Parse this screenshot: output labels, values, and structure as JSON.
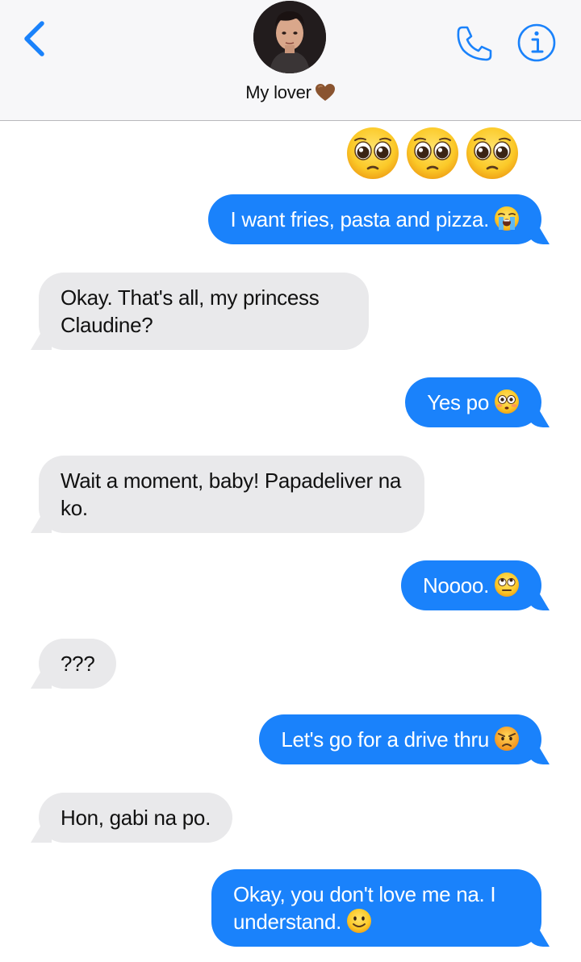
{
  "header": {
    "contact_name": "My lover",
    "name_icon": "brown-heart-icon",
    "back_icon": "chevron-left-icon",
    "call_icon": "phone-icon",
    "info_icon": "info-icon",
    "accent_color": "#1a82fb"
  },
  "messages": [
    {
      "direction": "outgoing",
      "text": "",
      "emoji": [
        "pleading-face-icon",
        "pleading-face-icon",
        "pleading-face-icon"
      ]
    },
    {
      "direction": "outgoing",
      "text": "I want fries, pasta and pizza.",
      "emoji": "loudly-crying-face-icon"
    },
    {
      "direction": "incoming",
      "text": "Okay. That's all, my princess Claudine?"
    },
    {
      "direction": "outgoing",
      "text": "Yes po",
      "emoji": "flushed-face-icon"
    },
    {
      "direction": "incoming",
      "text": "Wait a moment, baby! Papadeliver na ko."
    },
    {
      "direction": "outgoing",
      "text": "Noooo.",
      "emoji": "face-with-rolling-eyes-icon"
    },
    {
      "direction": "incoming",
      "text": "???"
    },
    {
      "direction": "outgoing",
      "text": "Let's go for a drive thru",
      "emoji": "angry-face-icon"
    },
    {
      "direction": "incoming",
      "text": "Hon, gabi na po."
    },
    {
      "direction": "outgoing",
      "text": "Okay, you don't love me na. I understand.",
      "emoji": "slightly-smiling-face-icon"
    }
  ],
  "colors": {
    "outgoing_bubble": "#1a82fb",
    "incoming_bubble": "#e9e9eb",
    "header_bg": "#f7f7f9"
  }
}
